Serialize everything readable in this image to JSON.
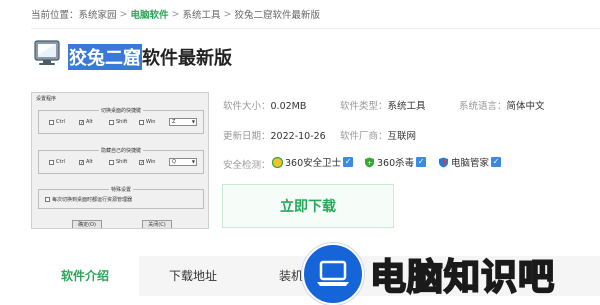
{
  "breadcrumb": {
    "label": "当前位置：",
    "items": [
      "系统家园",
      "电脑软件",
      "系统工具",
      "狡兔二窟软件最新版"
    ],
    "sep": ">"
  },
  "title": {
    "highlighted": "狡兔二窟",
    "rest": "软件最新版"
  },
  "screenshot": {
    "window_title": "设置程序",
    "group1_title": "切换桌面的快捷键",
    "group2_title": "隐藏自己的快捷键",
    "group3_title": "特殊设置",
    "ctrl": "Ctrl",
    "alt": "Alt",
    "shift": "Shift",
    "win": "Win",
    "key1": "Z",
    "key2": "Q",
    "special_option": "每次切换到桌面时都运行资源管理器",
    "ok": "确定(O)",
    "close": "关闭(C)"
  },
  "info": {
    "size_label": "软件大小：",
    "size_value": "0.02MB",
    "type_label": "软件类型：",
    "type_value": "系统工具",
    "lang_label": "系统语言：",
    "lang_value": "简体中文",
    "date_label": "更新日期：",
    "date_value": "2022-10-26",
    "vendor_label": "软件厂商：",
    "vendor_value": "互联网",
    "security_label": "安全检测："
  },
  "security": {
    "badge1": "360安全卫士",
    "badge2": "360杀毒",
    "badge3": "电脑管家"
  },
  "download_label": "立即下载",
  "tabs": [
    "软件介绍",
    "下载地址",
    "装机必"
  ],
  "watermark": "电脑知识吧",
  "colors": {
    "accent_green": "#2aa75a",
    "check_blue": "#3b8be6",
    "highlight_blue": "#3b78d8"
  }
}
